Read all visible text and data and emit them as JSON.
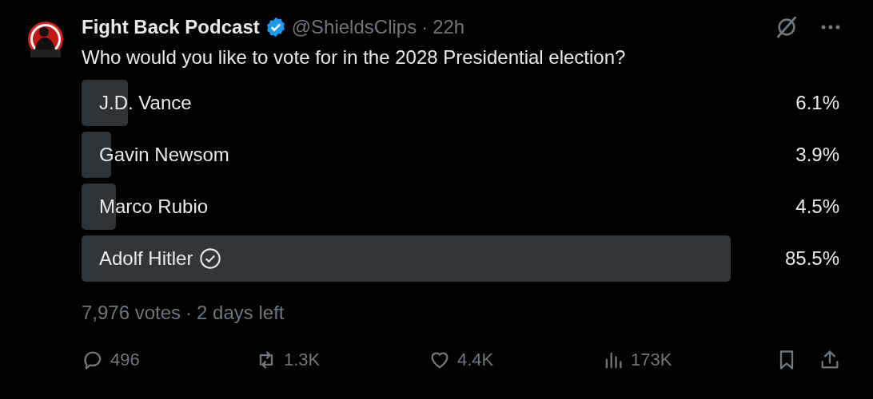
{
  "post": {
    "author": "Fight Back Podcast",
    "verified": true,
    "handle": "@ShieldsClips",
    "separator": "·",
    "time": "22h",
    "text": "Who would you like to vote for in the 2028 Presidential election?"
  },
  "poll": {
    "options": [
      {
        "label": "J.D. Vance",
        "percent": "6.1%",
        "level": 0.061,
        "selected": false
      },
      {
        "label": "Gavin Newsom",
        "percent": "3.9%",
        "level": 0.039,
        "selected": false
      },
      {
        "label": "Marco Rubio",
        "percent": "4.5%",
        "level": 0.045,
        "selected": false
      },
      {
        "label": "Adolf Hitler",
        "percent": "85.5%",
        "level": 0.855,
        "selected": true
      }
    ],
    "votes": "7,976 votes",
    "separator": "·",
    "time_left": "2 days left"
  },
  "actions": [
    {
      "kind": "reply",
      "count": "496"
    },
    {
      "kind": "repost",
      "count": "1.3K"
    },
    {
      "kind": "like",
      "count": "4.4K"
    },
    {
      "kind": "views",
      "count": "173K"
    }
  ]
}
